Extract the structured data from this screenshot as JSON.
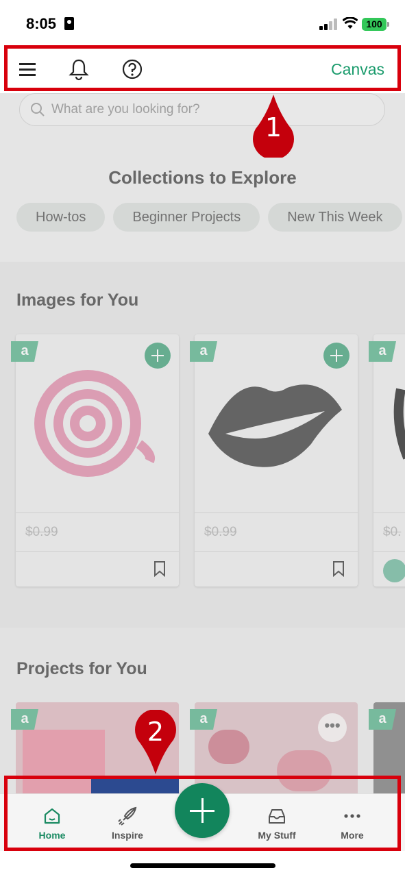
{
  "status_bar": {
    "time": "8:05",
    "battery": "100"
  },
  "toolbar": {
    "canvas_label": "Canvas"
  },
  "search": {
    "placeholder": "What are you looking for?"
  },
  "collections": {
    "title": "Collections to Explore",
    "chips": [
      "How-tos",
      "Beginner Projects",
      "New This Week"
    ]
  },
  "images_section": {
    "title": "Images for You",
    "cards": [
      {
        "price": "$0.99",
        "image": "pink-rolled-flower"
      },
      {
        "price": "$0.99",
        "image": "gray-lips"
      },
      {
        "price": "$0.",
        "image": "partial"
      }
    ]
  },
  "projects_section": {
    "title": "Projects for You"
  },
  "bottom_nav": {
    "items": [
      {
        "label": "Home",
        "icon": "home-icon",
        "active": true
      },
      {
        "label": "Inspire",
        "icon": "rocket-icon",
        "active": false
      },
      {
        "label": "My Stuff",
        "icon": "inbox-icon",
        "active": false
      },
      {
        "label": "More",
        "icon": "more-dots-icon",
        "active": false
      }
    ]
  },
  "annotations": {
    "marker_1": "1",
    "marker_2": "2"
  },
  "colors": {
    "accent": "#1a9b6c",
    "fab": "#12855c",
    "annotation": "#d8000c"
  }
}
